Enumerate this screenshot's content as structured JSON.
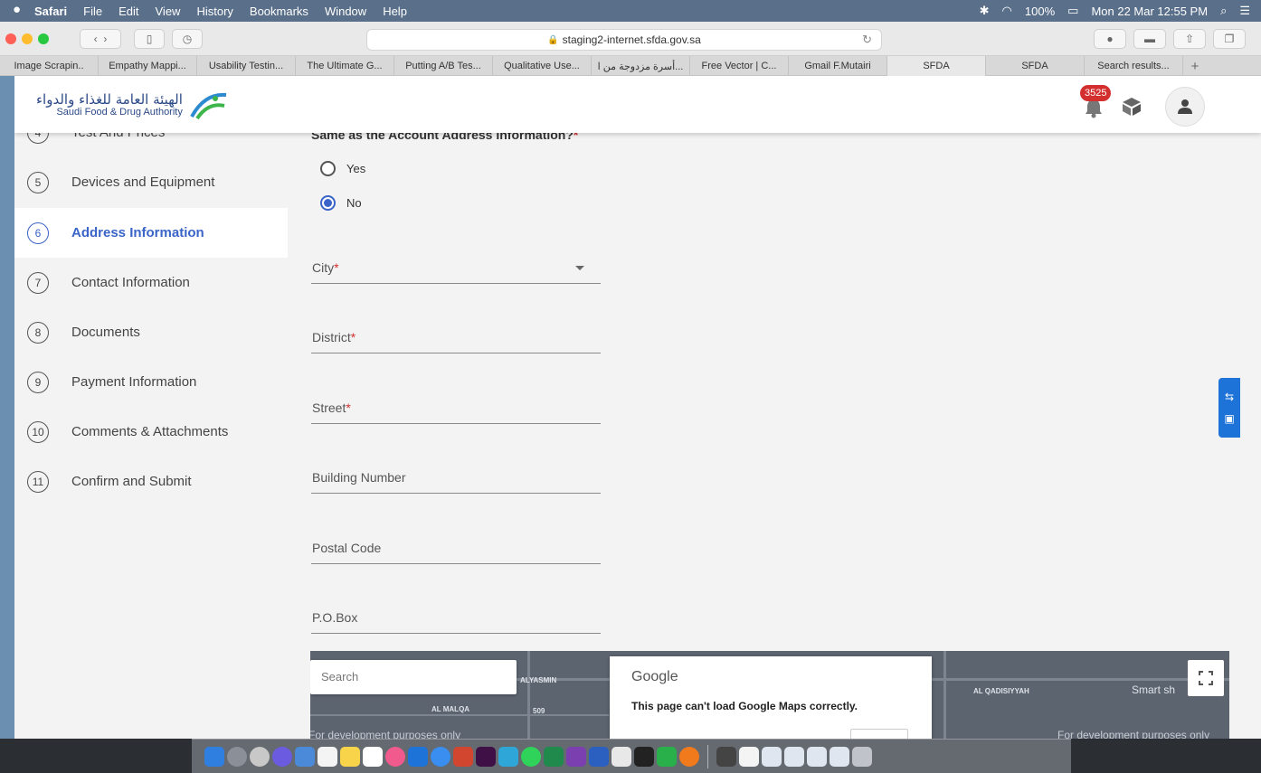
{
  "menubar": {
    "app_name": "Safari",
    "menus": [
      "File",
      "Edit",
      "View",
      "History",
      "Bookmarks",
      "Window",
      "Help"
    ],
    "battery": "100%",
    "datetime": "Mon 22 Mar  12:55 PM"
  },
  "browser": {
    "url": "staging2-internet.sfda.gov.sa",
    "tabs": [
      "Image Scrapin..",
      "Empathy Mappi...",
      "Usability Testin...",
      "The Ultimate G...",
      "Putting A/B Tes...",
      "Qualitative Use...",
      "أسرة مزدوجة من ا...",
      "Free Vector | C...",
      "Gmail F.Mutairi",
      "SFDA",
      "SFDA",
      "Search results..."
    ],
    "active_tab_index": 9
  },
  "header": {
    "logo_arabic": "الهيئة العامة للغذاء والدواء",
    "logo_english": "Saudi Food & Drug Authority",
    "notification_count": "3525"
  },
  "sidebar": {
    "steps": [
      {
        "num": "4",
        "label": "Test And Prices"
      },
      {
        "num": "5",
        "label": "Devices and Equipment"
      },
      {
        "num": "6",
        "label": "Address Information"
      },
      {
        "num": "7",
        "label": "Contact Information"
      },
      {
        "num": "8",
        "label": "Documents"
      },
      {
        "num": "9",
        "label": "Payment Information"
      },
      {
        "num": "10",
        "label": "Comments & Attachments"
      },
      {
        "num": "11",
        "label": "Confirm and Submit"
      }
    ]
  },
  "form": {
    "question": "Same as the Account Address Information?",
    "req_mark": "*",
    "options": {
      "yes": "Yes",
      "no": "No"
    },
    "selected": "No",
    "fields": {
      "city": "City",
      "district": "District",
      "street": "Street",
      "building": "Building Number",
      "postal": "Postal Code",
      "pobox": "P.O.Box"
    }
  },
  "map": {
    "search_placeholder": "Search",
    "dialog_brand": "Google",
    "dialog_message": "This page can't load Google Maps correctly.",
    "dev_text": "For development purposes only",
    "labels": {
      "alyasmin": "ALYASMIN",
      "almalqa": "AL MALQA",
      "alqadisiyyah": "AL QADISIYYAH",
      "smart": "Smart sh",
      "road509": "509"
    }
  }
}
